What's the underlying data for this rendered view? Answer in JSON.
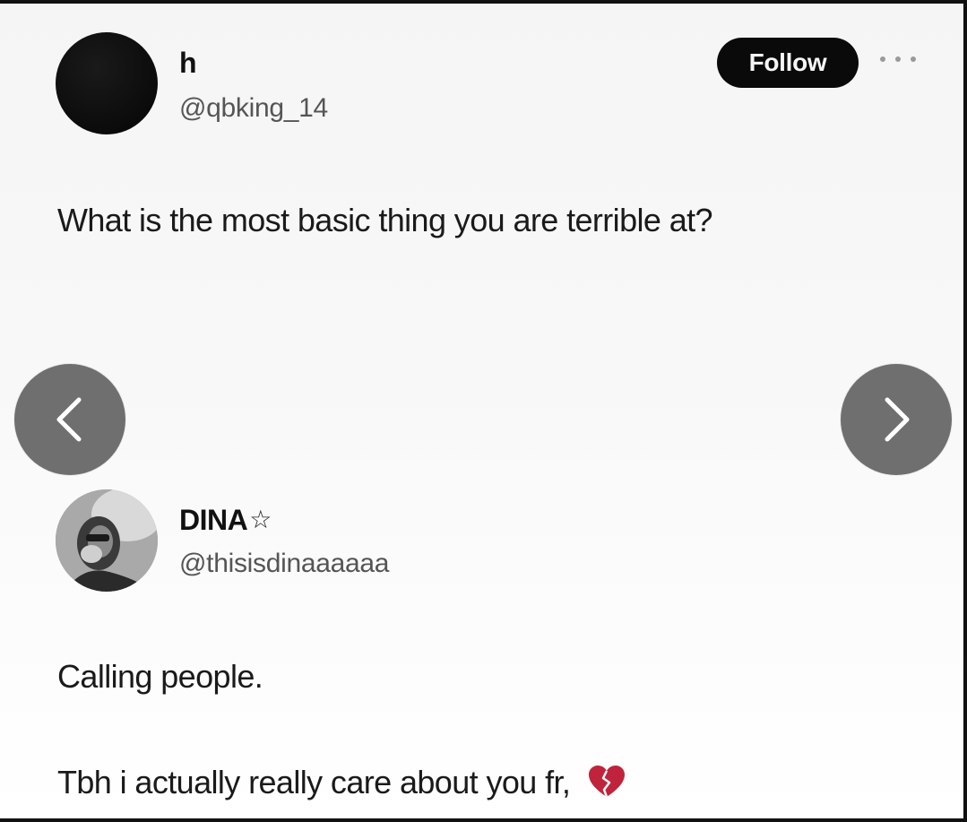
{
  "original_post": {
    "display_name": "h",
    "handle": "@qbking_14",
    "follow_label": "Follow",
    "text": "What is the most basic thing you are terrible at?"
  },
  "reply": {
    "display_name": "DINA",
    "star": "☆",
    "handle": "@thisisdinaaaaaa",
    "line_1": "Calling people.",
    "line_2": "Tbh i actually really care about you fr,"
  },
  "icons": {
    "more": "more-options-icon",
    "prev": "chevron-left-icon",
    "next": "chevron-right-icon",
    "heart": "broken-heart-icon"
  },
  "colors": {
    "follow_bg": "#0a0a0a",
    "nav_bg": "#6f6f6f",
    "heart": "#c0243c"
  }
}
